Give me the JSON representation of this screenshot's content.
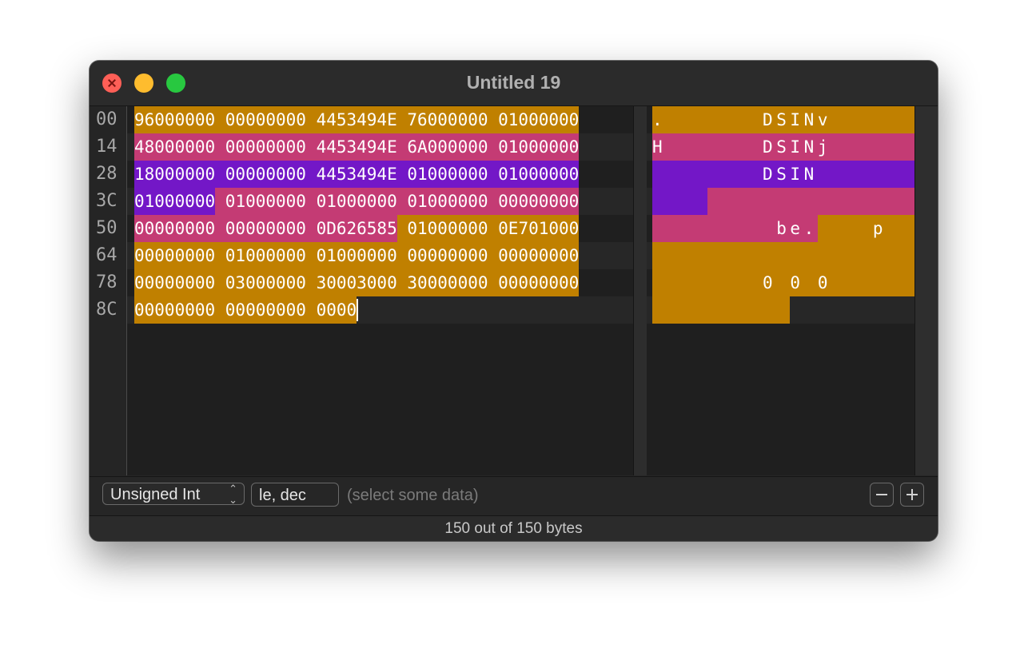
{
  "window": {
    "title": "Untitled 19"
  },
  "offsets": [
    "00",
    "14",
    "28",
    "3C",
    "50",
    "64",
    "78",
    "8C"
  ],
  "hex_rows": [
    [
      {
        "t": "96000000 00000000 4453494E 76000000 01000000",
        "c": "c1"
      }
    ],
    [
      {
        "t": "48000000 00000000 4453494E 6A000000 01000000",
        "c": "c2"
      }
    ],
    [
      {
        "t": "18000000 00000000 4453494E 01000000 01000000",
        "c": "c3"
      }
    ],
    [
      {
        "t": "01000000",
        "c": "c3"
      },
      {
        "t": " 01000000 01000000 01000000 00000000",
        "c": "c2"
      }
    ],
    [
      {
        "t": "00000000 00000000 0D626585",
        "c": "c2"
      },
      {
        "t": " 01000000 0E701000",
        "c": "c1"
      }
    ],
    [
      {
        "t": "00000000 01000000 01000000 00000000 00000000",
        "c": "c1"
      }
    ],
    [
      {
        "t": "00000000 03000000 30003000 30000000 00000000",
        "c": "c1"
      }
    ],
    [
      {
        "t": "00000000 00000000 0000",
        "c": "c1"
      }
    ]
  ],
  "ascii_rows": [
    [
      {
        "t": ".       DSINv       ",
        "c": "c1"
      }
    ],
    [
      {
        "t": "H       DSINj       ",
        "c": "c2"
      }
    ],
    [
      {
        "t": "        DSIN        ",
        "c": "c3"
      }
    ],
    [
      {
        "t": "    ",
        "c": "c3"
      },
      {
        "t": "                ",
        "c": "c2"
      }
    ],
    [
      {
        "t": "         be.",
        "c": "c2"
      },
      {
        "t": "    p   ",
        "c": "c1"
      }
    ],
    [
      {
        "t": "                    ",
        "c": "c1"
      }
    ],
    [
      {
        "t": "        0 0 0       ",
        "c": "c1"
      }
    ],
    [
      {
        "t": "          ",
        "c": "c1"
      }
    ]
  ],
  "inspector": {
    "type_label": "Unsigned Int",
    "format_value": "le, dec",
    "value_placeholder": "(select some data)"
  },
  "status": {
    "text": "150 out of 150 bytes"
  },
  "colors": {
    "group1": "#c08000",
    "group2": "#c43b74",
    "group3": "#7317c7",
    "background": "#1f1f1f"
  }
}
